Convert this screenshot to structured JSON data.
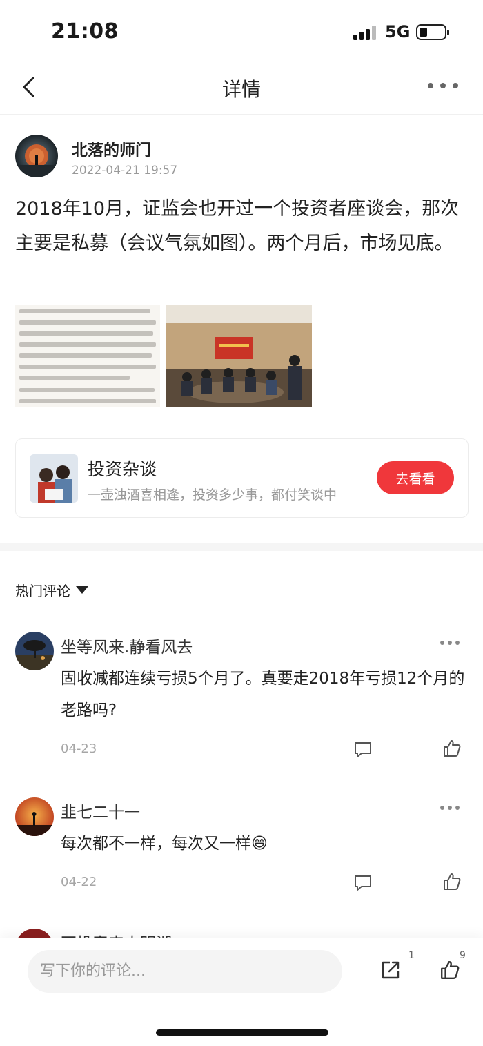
{
  "status_bar": {
    "time": "21:08",
    "network": "5G"
  },
  "nav": {
    "title": "详情"
  },
  "post": {
    "author": "北落的师门",
    "time": "2022-04-21 19:57",
    "text": "2018年10月，证监会也开过一个投资者座谈会，那次主要是私募（会议气氛如图）。两个月后，市场见底。",
    "images": [
      "news-text-screenshot",
      "meeting-photo"
    ]
  },
  "channel_card": {
    "title": "投资杂谈",
    "description": "一壶浊酒喜相逢，投资多少事，都付笑谈中",
    "button": "去看看"
  },
  "comments_section": {
    "label": "热门评论",
    "comments": [
      {
        "name": "坐等风来.静看风去",
        "text": "固收减都连续亏损5个月了。真要走2018年亏损12个月的老路吗?",
        "date": "04-23"
      },
      {
        "name": "韭七二十一",
        "text": "每次都不一样，每次又一样😄",
        "date": "04-22"
      },
      {
        "name": "不投春来太明湖"
      }
    ]
  },
  "bottom_bar": {
    "input_placeholder": "写下你的评论...",
    "share_count": "1",
    "like_count": "9"
  },
  "colors": {
    "accent": "#f0373b",
    "text": "#222222",
    "muted": "#999999"
  }
}
